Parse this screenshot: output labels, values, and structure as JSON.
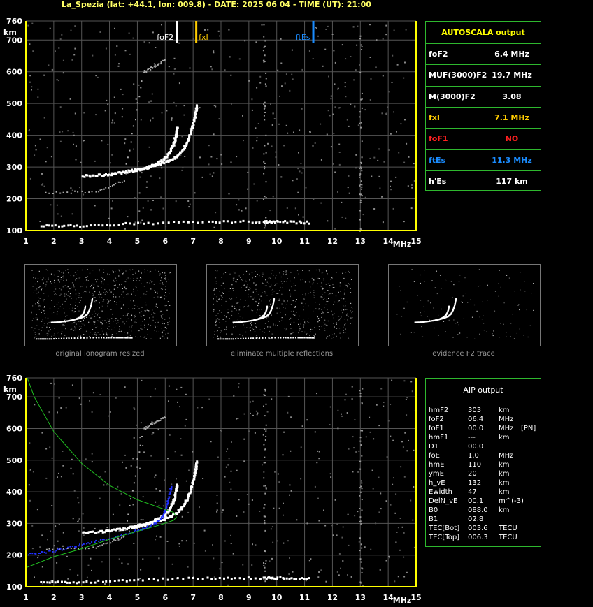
{
  "title": "La_Spezia (lat: +44.1, lon: 009.8) - DATE: 2025 06 04 - TIME (UT): 21:00",
  "colors": {
    "axis": "#ffff00",
    "grid": "#555555",
    "panel_border": "#2eb82e",
    "foF2": "#ffffff",
    "fxI": "#ffcc00",
    "ftEs": "#1a8cff",
    "foF1": "#ff2020",
    "profile": "#20c020",
    "aip_trace": "#2030ff"
  },
  "chart_data": [
    {
      "type": "scatter",
      "name": "ionogram-top",
      "xlabel": "MHz",
      "ylabel": "km",
      "xlim": [
        1,
        15
      ],
      "ylim": [
        100,
        760
      ],
      "x_ticks": [
        "1",
        "2",
        "3",
        "4",
        "5",
        "6",
        "7",
        "8",
        "9",
        "10",
        "11",
        "12",
        "13",
        "14",
        "15"
      ],
      "y_ticks": [
        "100",
        "200",
        "300",
        "400",
        "500",
        "600",
        "700",
        "760"
      ],
      "grid": true,
      "markers": [
        {
          "label": "foF2",
          "x": 6.4
        },
        {
          "label": "fxI",
          "x": 7.1
        },
        {
          "label": "ftEs",
          "x": 11.3
        }
      ],
      "traces": {
        "f2_o": [
          [
            3.0,
            275
          ],
          [
            3.8,
            278
          ],
          [
            4.4,
            285
          ],
          [
            5.0,
            295
          ],
          [
            5.5,
            307
          ],
          [
            5.9,
            325
          ],
          [
            6.1,
            345
          ],
          [
            6.25,
            370
          ],
          [
            6.35,
            400
          ],
          [
            6.4,
            430
          ]
        ],
        "f2_x": [
          [
            4.8,
            290
          ],
          [
            5.3,
            300
          ],
          [
            5.8,
            312
          ],
          [
            6.3,
            330
          ],
          [
            6.6,
            355
          ],
          [
            6.8,
            390
          ],
          [
            6.95,
            430
          ],
          [
            7.05,
            470
          ],
          [
            7.1,
            500
          ]
        ],
        "es": [
          [
            1.5,
            118
          ],
          [
            3.0,
            118
          ],
          [
            5.0,
            125
          ],
          [
            7.5,
            130
          ],
          [
            9.5,
            130
          ],
          [
            10.0,
            130
          ],
          [
            11.2,
            128
          ]
        ],
        "multiple": [
          [
            1.7,
            220
          ],
          [
            3.5,
            225
          ],
          [
            4.5,
            260
          ],
          [
            5.2,
            600
          ],
          [
            5.6,
            620
          ],
          [
            6.0,
            640
          ]
        ]
      }
    },
    {
      "type": "scatter",
      "name": "ionogram-bottom",
      "xlabel": "MHz",
      "ylabel": "km",
      "xlim": [
        1,
        15
      ],
      "ylim": [
        100,
        760
      ],
      "x_ticks": [
        "1",
        "2",
        "3",
        "4",
        "5",
        "6",
        "7",
        "8",
        "9",
        "10",
        "11",
        "12",
        "13",
        "14",
        "15"
      ],
      "y_ticks": [
        "100",
        "200",
        "300",
        "400",
        "500",
        "600",
        "700",
        "760"
      ],
      "grid": true,
      "profile": [
        [
          1.0,
          160
        ],
        [
          2.0,
          195
        ],
        [
          3.0,
          220
        ],
        [
          4.0,
          250
        ],
        [
          5.0,
          275
        ],
        [
          5.8,
          295
        ],
        [
          6.3,
          310
        ],
        [
          6.4,
          320
        ],
        [
          6.3,
          335
        ],
        [
          5.8,
          350
        ],
        [
          5.0,
          375
        ],
        [
          4.0,
          420
        ],
        [
          3.0,
          490
        ],
        [
          2.0,
          590
        ],
        [
          1.3,
          700
        ],
        [
          1.05,
          760
        ]
      ],
      "aip_trace": [
        [
          1.0,
          205
        ],
        [
          2.0,
          215
        ],
        [
          3.0,
          235
        ],
        [
          4.0,
          255
        ],
        [
          5.0,
          280
        ],
        [
          5.6,
          300
        ],
        [
          5.9,
          325
        ],
        [
          6.0,
          350
        ],
        [
          6.1,
          380
        ],
        [
          6.2,
          420
        ]
      ]
    }
  ],
  "autoscala": {
    "title": "AUTOSCALA output",
    "rows": [
      {
        "label": "foF2",
        "value": "6.4 MHz",
        "color": "#ffffff"
      },
      {
        "label": "MUF(3000)F2",
        "value": "19.7 MHz",
        "color": "#ffffff"
      },
      {
        "label": "M(3000)F2",
        "value": "3.08",
        "color": "#ffffff"
      },
      {
        "label": "fxI",
        "value": "7.1 MHz",
        "color": "#ffcc00"
      },
      {
        "label": "foF1",
        "value": "NO",
        "color": "#ff2020"
      },
      {
        "label": "ftEs",
        "value": "11.3 MHz",
        "color": "#1a8cff"
      },
      {
        "label": "h'Es",
        "value": "117    km",
        "color": "#ffffff"
      }
    ]
  },
  "aip": {
    "title": "AIP output",
    "rows": [
      [
        "hmF2",
        "303",
        "km",
        ""
      ],
      [
        "foF2",
        "06.4",
        "MHz",
        ""
      ],
      [
        "foF1",
        "00.0",
        "MHz",
        "[PN]"
      ],
      [
        "hmF1",
        "---",
        "km",
        ""
      ],
      [
        "D1",
        "00.0",
        "",
        ""
      ],
      [
        "foE",
        "1.0",
        "MHz",
        ""
      ],
      [
        "hmE",
        "110",
        "km",
        ""
      ],
      [
        "ymE",
        "20",
        "km",
        ""
      ],
      [
        "h_vE",
        "132",
        "km",
        ""
      ],
      [
        "Ewidth",
        "47",
        "km",
        ""
      ],
      [
        "DelN_vE",
        "00.1",
        "m^(-3)",
        ""
      ],
      [
        "B0",
        "088.0",
        "km",
        ""
      ],
      [
        "B1",
        "02.8",
        "",
        ""
      ],
      [
        "TEC[Bot]",
        "003.6",
        "TECU",
        ""
      ],
      [
        "TEC[Top]",
        "006.3",
        "TECU",
        ""
      ]
    ]
  },
  "captions": [
    "original ionogram resized",
    "eliminate multiple reflections",
    "evidence F2 trace"
  ]
}
